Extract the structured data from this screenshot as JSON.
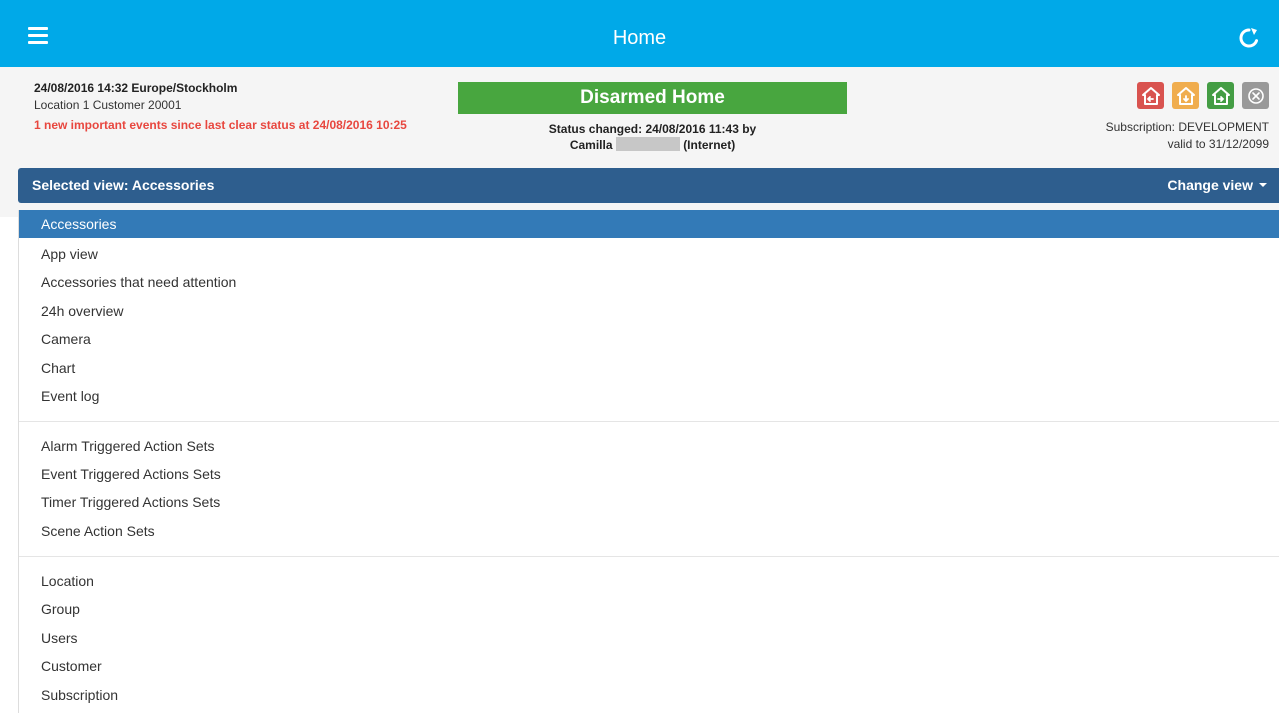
{
  "header": {
    "title": "Home"
  },
  "status": {
    "datetime": "24/08/2016 14:32 Europe/Stockholm",
    "location": "Location 1 Customer 20001",
    "alert": "1 new important events since last clear status at 24/08/2016 10:25",
    "state": "Disarmed Home",
    "state_color": "#48a63f",
    "changed_line1": "Status changed: 24/08/2016 11:43 by",
    "changed_name": "Camilla",
    "changed_via": "(Internet)",
    "subscription": "Subscription: DEVELOPMENT",
    "valid_to": "valid to 31/12/2099"
  },
  "actions": [
    {
      "icon": "arm-away-icon",
      "color": "#d9534f"
    },
    {
      "icon": "arm-home-icon",
      "color": "#f0ad4e"
    },
    {
      "icon": "disarm-icon",
      "color": "#449d44"
    },
    {
      "icon": "cancel-icon",
      "color": "#999999"
    }
  ],
  "viewbar": {
    "selected": "Selected view: Accessories",
    "change": "Change view"
  },
  "menu": {
    "group1": [
      "Accessories",
      "App view",
      "Accessories that need attention",
      "24h overview",
      "Camera",
      "Chart",
      "Event log"
    ],
    "group2": [
      "Alarm Triggered Action Sets",
      "Event Triggered Actions Sets",
      "Timer Triggered Actions Sets",
      "Scene Action Sets"
    ],
    "group3": [
      "Location",
      "Group",
      "Users",
      "Customer",
      "Subscription"
    ]
  }
}
